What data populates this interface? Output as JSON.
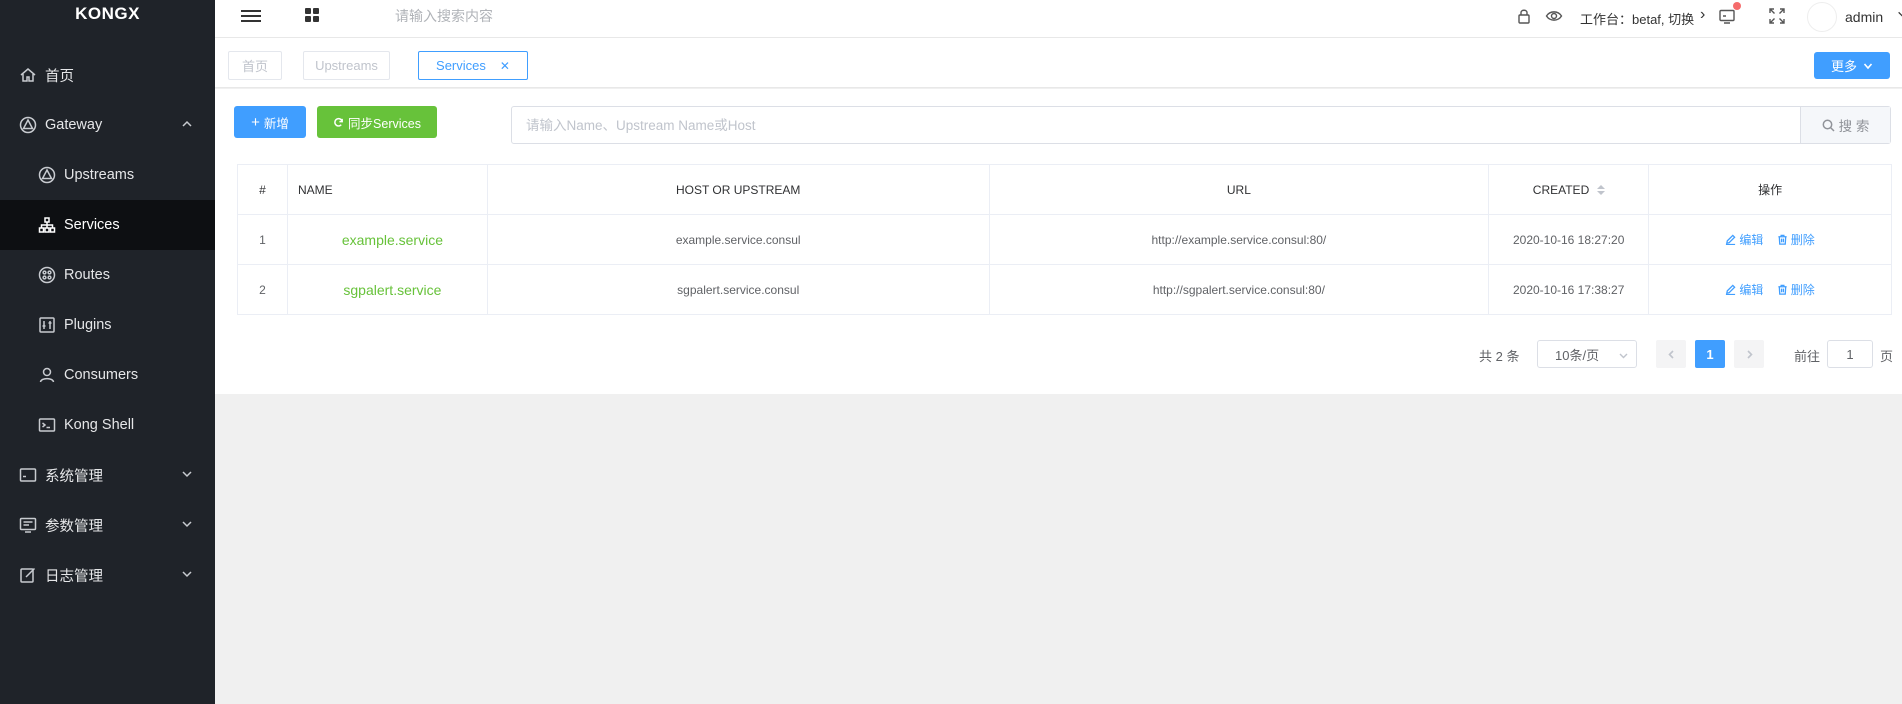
{
  "app": {
    "logo": "KONGX"
  },
  "sidebar": {
    "items": [
      {
        "label": "首页",
        "icon": "home-icon"
      },
      {
        "label": "Gateway",
        "icon": "gateway-icon",
        "expanded": true
      },
      {
        "label": "Upstreams",
        "icon": "upstreams-icon"
      },
      {
        "label": "Services",
        "icon": "services-icon",
        "active": true
      },
      {
        "label": "Routes",
        "icon": "routes-icon"
      },
      {
        "label": "Plugins",
        "icon": "plugins-icon"
      },
      {
        "label": "Consumers",
        "icon": "user-icon"
      },
      {
        "label": "Kong Shell",
        "icon": "terminal-icon"
      },
      {
        "label": "系统管理",
        "icon": "system-icon"
      },
      {
        "label": "参数管理",
        "icon": "params-icon"
      },
      {
        "label": "日志管理",
        "icon": "log-icon"
      }
    ]
  },
  "header": {
    "search_placeholder": "请输入搜索内容",
    "workspace": "工作台：betaf, 切换",
    "user": "admin"
  },
  "tabs": [
    {
      "label": "首页"
    },
    {
      "label": "Upstreams"
    },
    {
      "label": "Services",
      "active": true,
      "closable": true
    }
  ],
  "more_button": "更多",
  "toolbar": {
    "add_label": "新增",
    "sync_label": "同步Services",
    "search_placeholder": "请输入Name、Upstream Name或Host",
    "search_label": "搜 索"
  },
  "table": {
    "headers": [
      "#",
      "NAME",
      "HOST OR UPSTREAM",
      "URL",
      "CREATED",
      "操作"
    ],
    "rows": [
      {
        "idx": "1",
        "name": "example.service",
        "host": "example.service.consul",
        "url": "http://example.service.consul:80/",
        "created": "2020-10-16 18:27:20"
      },
      {
        "idx": "2",
        "name": "sgpalert.service",
        "host": "sgpalert.service.consul",
        "url": "http://sgpalert.service.consul:80/",
        "created": "2020-10-16 17:38:27"
      }
    ],
    "edit_label": "编辑",
    "delete_label": "删除"
  },
  "pagination": {
    "total": "共 2 条",
    "page_size": "10条/页",
    "current": "1",
    "goto_label": "前往",
    "goto_value": "1",
    "unit": "页"
  },
  "colors": {
    "primary": "#409eff",
    "success": "#67c23a",
    "sidebar": "#1f2329"
  }
}
